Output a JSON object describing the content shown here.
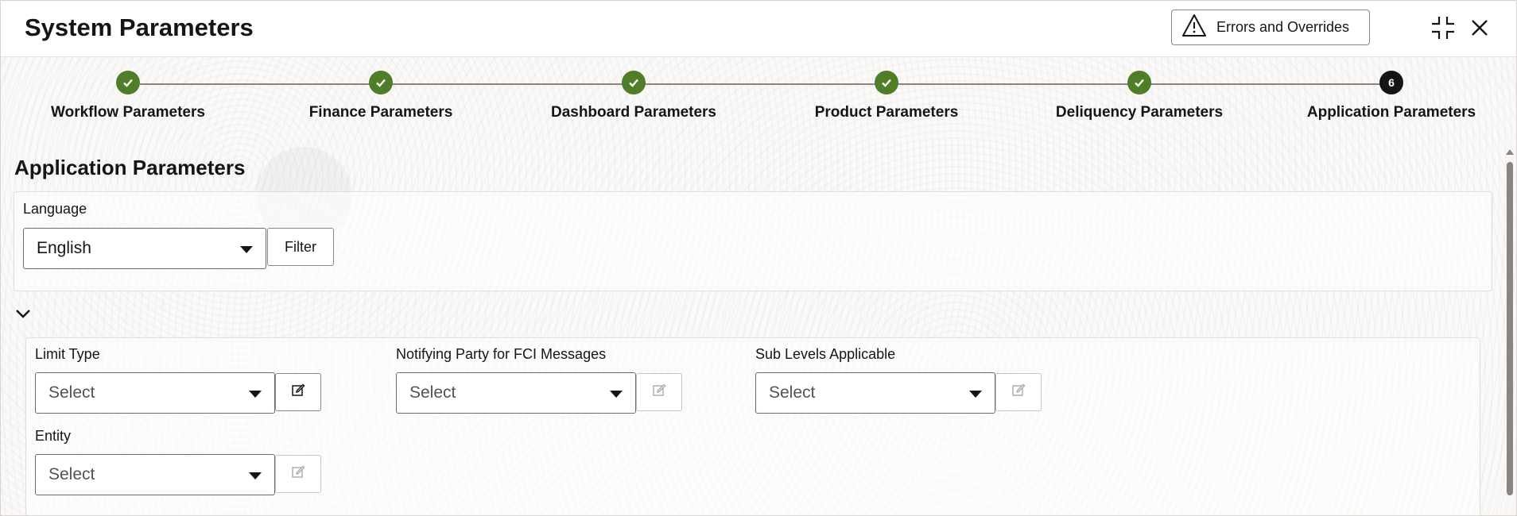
{
  "header": {
    "title": "System Parameters",
    "errors_button_label": "Errors and Overrides"
  },
  "stepper": {
    "steps": [
      {
        "label": "Workflow Parameters",
        "status": "done"
      },
      {
        "label": "Finance Parameters",
        "status": "done"
      },
      {
        "label": "Dashboard Parameters",
        "status": "done"
      },
      {
        "label": "Product Parameters",
        "status": "done"
      },
      {
        "label": "Deliquency Parameters",
        "status": "done"
      },
      {
        "label": "Application Parameters",
        "status": "current",
        "number": "6"
      }
    ]
  },
  "section": {
    "title": "Application Parameters",
    "language_label": "Language",
    "language_value": "English",
    "filter_label": "Filter"
  },
  "params": {
    "limit_type": {
      "label": "Limit Type",
      "value": "Select"
    },
    "notifying_party": {
      "label": "Notifying Party for FCI Messages",
      "value": "Select"
    },
    "sub_levels": {
      "label": "Sub Levels Applicable",
      "value": "Select"
    },
    "entity": {
      "label": "Entity",
      "value": "Select"
    }
  },
  "colors": {
    "done": "#4f7d28",
    "current": "#161513"
  },
  "icons": [
    "warning-icon",
    "collapse-icon",
    "close-icon",
    "check-icon",
    "chevron-down-icon",
    "edit-icon"
  ]
}
